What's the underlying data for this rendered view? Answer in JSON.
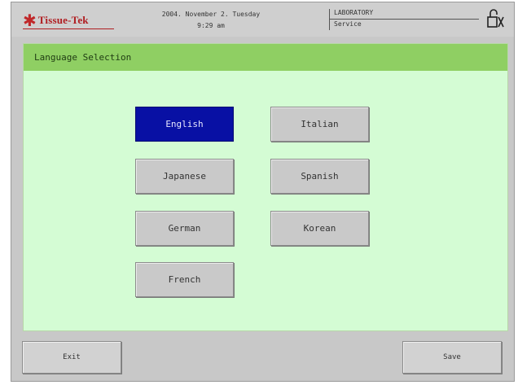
{
  "header": {
    "logo_text": "Tissue-Tek",
    "logo_icon": "star-icon",
    "date_line": "2004. November 2. Tuesday",
    "time_line": "9:29 am",
    "department": "LABORATORY",
    "role": "Service",
    "lock_icon": "lock-icon"
  },
  "panel": {
    "title": "Language Selection",
    "languages": [
      {
        "label": "English",
        "selected": true
      },
      {
        "label": "Italian",
        "selected": false
      },
      {
        "label": "Japanese",
        "selected": false
      },
      {
        "label": "Spanish",
        "selected": false
      },
      {
        "label": "German",
        "selected": false
      },
      {
        "label": "Korean",
        "selected": false
      },
      {
        "label": "French",
        "selected": false
      }
    ]
  },
  "footer": {
    "exit_label": "Exit",
    "save_label": "Save"
  },
  "colors": {
    "selected_button": "#0810a4",
    "panel_background": "#d4fcd4",
    "panel_title_bar": "#8fcf63",
    "brand_red": "#b01e22"
  }
}
